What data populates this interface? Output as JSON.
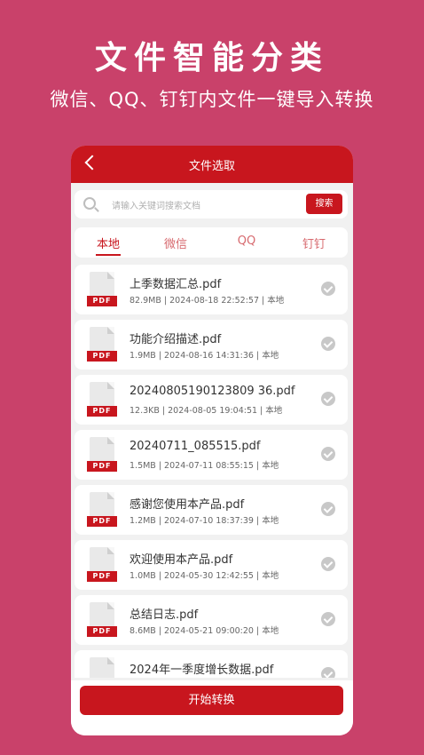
{
  "hero": {
    "title": "文件智能分类",
    "subtitle": "微信、QQ、钉钉内文件一键导入转换"
  },
  "header": {
    "title": "文件选取"
  },
  "search": {
    "placeholder": "请输入关键词搜索文档",
    "button": "搜索"
  },
  "tabs": [
    {
      "label": "本地",
      "active": true
    },
    {
      "label": "微信",
      "active": false
    },
    {
      "label": "QQ",
      "active": false
    },
    {
      "label": "钉钉",
      "active": false
    }
  ],
  "file_badge": "PDF",
  "files": [
    {
      "name": "上季数据汇总.pdf",
      "meta": "82.9MB | 2024-08-18 22:52:57 | 本地"
    },
    {
      "name": "功能介绍描述.pdf",
      "meta": "1.9MB | 2024-08-16 14:31:36 | 本地"
    },
    {
      "name": "20240805190123809 36.pdf",
      "meta": "12.3KB | 2024-08-05 19:04:51 | 本地"
    },
    {
      "name": "20240711_085515.pdf",
      "meta": "1.5MB | 2024-07-11 08:55:15 | 本地"
    },
    {
      "name": "感谢您使用本产品.pdf",
      "meta": "1.2MB | 2024-07-10 18:37:39 | 本地"
    },
    {
      "name": "欢迎使用本产品.pdf",
      "meta": "1.0MB | 2024-05-30 12:42:55 | 本地"
    },
    {
      "name": "总结日志.pdf",
      "meta": "8.6MB | 2024-05-21 09:00:20 | 本地"
    },
    {
      "name": "2024年一季度增长数据.pdf",
      "meta": ""
    }
  ],
  "footer": {
    "start_button": "开始转换"
  },
  "colors": {
    "background": "#c9416a",
    "accent": "#c8161e"
  }
}
